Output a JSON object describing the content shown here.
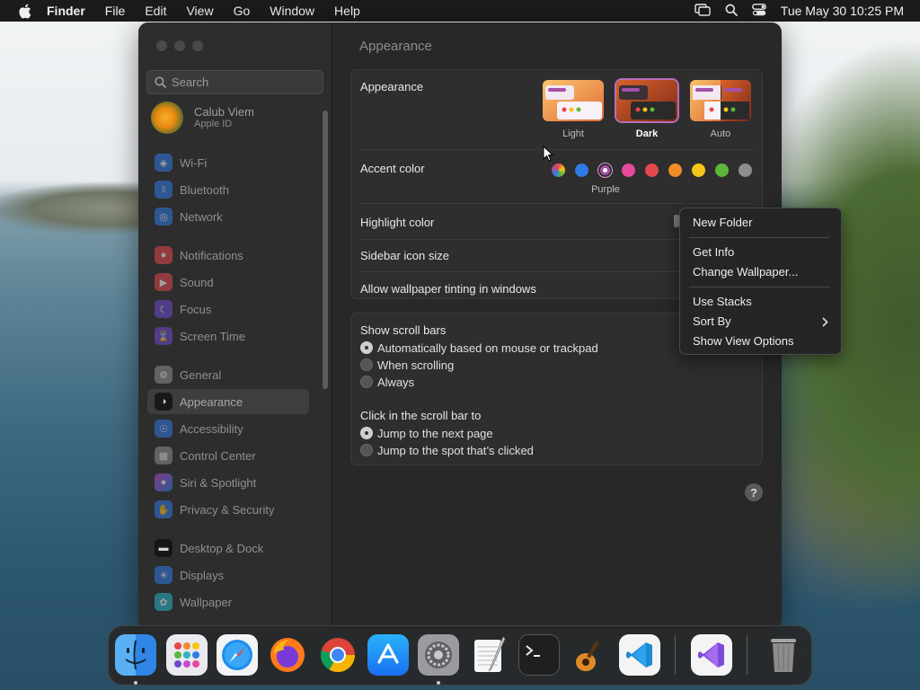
{
  "menubar": {
    "app_name": "Finder",
    "menus": [
      "File",
      "Edit",
      "View",
      "Go",
      "Window",
      "Help"
    ],
    "clock": "Tue May 30  10:25 PM"
  },
  "sidebar": {
    "search_placeholder": "Search",
    "user_name": "Calub Viem",
    "user_sub": "Apple ID",
    "items": [
      {
        "label": "Wi-Fi",
        "color": "#2f7ae5"
      },
      {
        "label": "Bluetooth",
        "color": "#2f7ae5"
      },
      {
        "label": "Network",
        "color": "#2f7ae5"
      },
      {
        "label": "Notifications",
        "color": "#e5484d"
      },
      {
        "label": "Sound",
        "color": "#e5484d"
      },
      {
        "label": "Focus",
        "color": "#6e4ad1"
      },
      {
        "label": "Screen Time",
        "color": "#6e4ad1"
      },
      {
        "label": "General",
        "color": "#8e8e8e"
      },
      {
        "label": "Appearance",
        "color": "#1c1c1c"
      },
      {
        "label": "Accessibility",
        "color": "#2f7ae5"
      },
      {
        "label": "Control Center",
        "color": "#8e8e8e"
      },
      {
        "label": "Siri & Spotlight",
        "color": "#c44bd6"
      },
      {
        "label": "Privacy & Security",
        "color": "#2f7ae5"
      },
      {
        "label": "Desktop & Dock",
        "color": "#1c1c1c"
      },
      {
        "label": "Displays",
        "color": "#2f7ae5"
      },
      {
        "label": "Wallpaper",
        "color": "#29b6c9"
      }
    ]
  },
  "main": {
    "title": "Appearance",
    "appearance_label": "Appearance",
    "themes": [
      {
        "label": "Light",
        "selected": false
      },
      {
        "label": "Dark",
        "selected": true
      },
      {
        "label": "Auto",
        "selected": false
      }
    ],
    "accent_label": "Accent color",
    "accent_selected_name": "Purple",
    "accent_colors": [
      "multicolor",
      "#2f7ae5",
      "#a550a7",
      "#e64a9a",
      "#e5484d",
      "#f28c28",
      "#f5c518",
      "#5cb83b",
      "#8e8e8e"
    ],
    "highlight_label": "Highlight color",
    "sidebar_icon_label": "Sidebar icon size",
    "tinting_label": "Allow wallpaper tinting in windows",
    "scroll_title": "Show scroll bars",
    "scroll_options": [
      "Automatically based on mouse or trackpad",
      "When scrolling",
      "Always"
    ],
    "click_title": "Click in the scroll bar to",
    "click_options": [
      "Jump to the next page",
      "Jump to the spot that’s clicked"
    ],
    "help": "?"
  },
  "context_menu": {
    "new_folder": "New Folder",
    "get_info": "Get Info",
    "change_wallpaper": "Change Wallpaper...",
    "use_stacks": "Use Stacks",
    "sort_by": "Sort By",
    "show_view_options": "Show View Options"
  },
  "dock": {
    "apps": [
      "finder-icon",
      "launchpad-icon",
      "safari-icon",
      "firefox-icon",
      "chrome-icon",
      "app-store-icon",
      "system-settings-icon",
      "textedit-icon",
      "terminal-icon",
      "garageband-icon",
      "vscode-icon",
      "visual-studio-icon",
      "trash-icon"
    ]
  }
}
